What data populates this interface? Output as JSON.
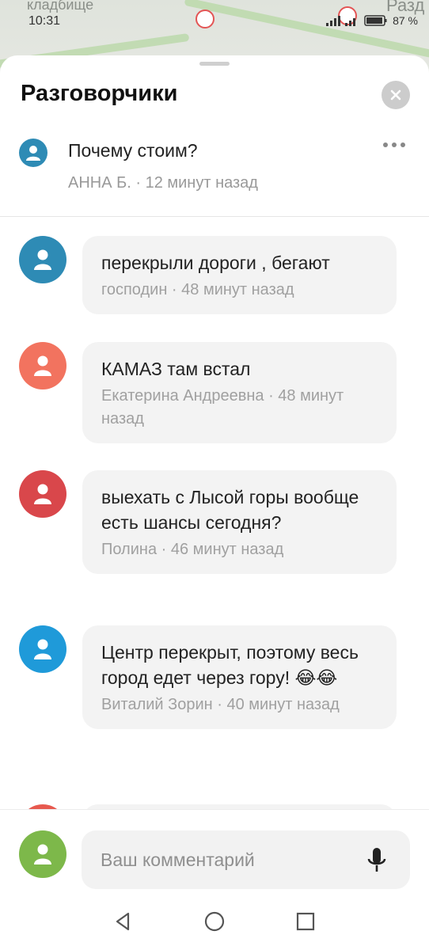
{
  "status": {
    "time": "10:31",
    "battery": "87 %"
  },
  "map": {
    "label_left": "кладбище",
    "label_right": "Разд"
  },
  "sheet": {
    "title": "Разговорчики",
    "close_icon": "close-icon"
  },
  "topic": {
    "title": "Почему стоим?",
    "meta": "АННА Б. · 12 минут назад"
  },
  "comments": [
    {
      "text": "перекрыли дороги , бегают",
      "meta": "господин · 48 минут назад",
      "avatar_color": "#2e8bb5"
    },
    {
      "text": "КАМАЗ там встал",
      "meta": "Екатерина Андреевна · 48 минут назад",
      "avatar_color": "#f2735f"
    },
    {
      "text": "выехать  с Лысой горы вообще есть шансы сегодня?",
      "meta": "Полина · 46 минут назад",
      "avatar_color": "#d9474b"
    },
    {
      "text": "Центр перекрыт, поэтому весь город едет через гору! 😂😂",
      "meta": "Виталий Зорин · 40 минут назад",
      "avatar_color": "#1f9ad9"
    }
  ],
  "composer": {
    "placeholder": "Ваш комментарий",
    "avatar_color": "#7db84a"
  }
}
